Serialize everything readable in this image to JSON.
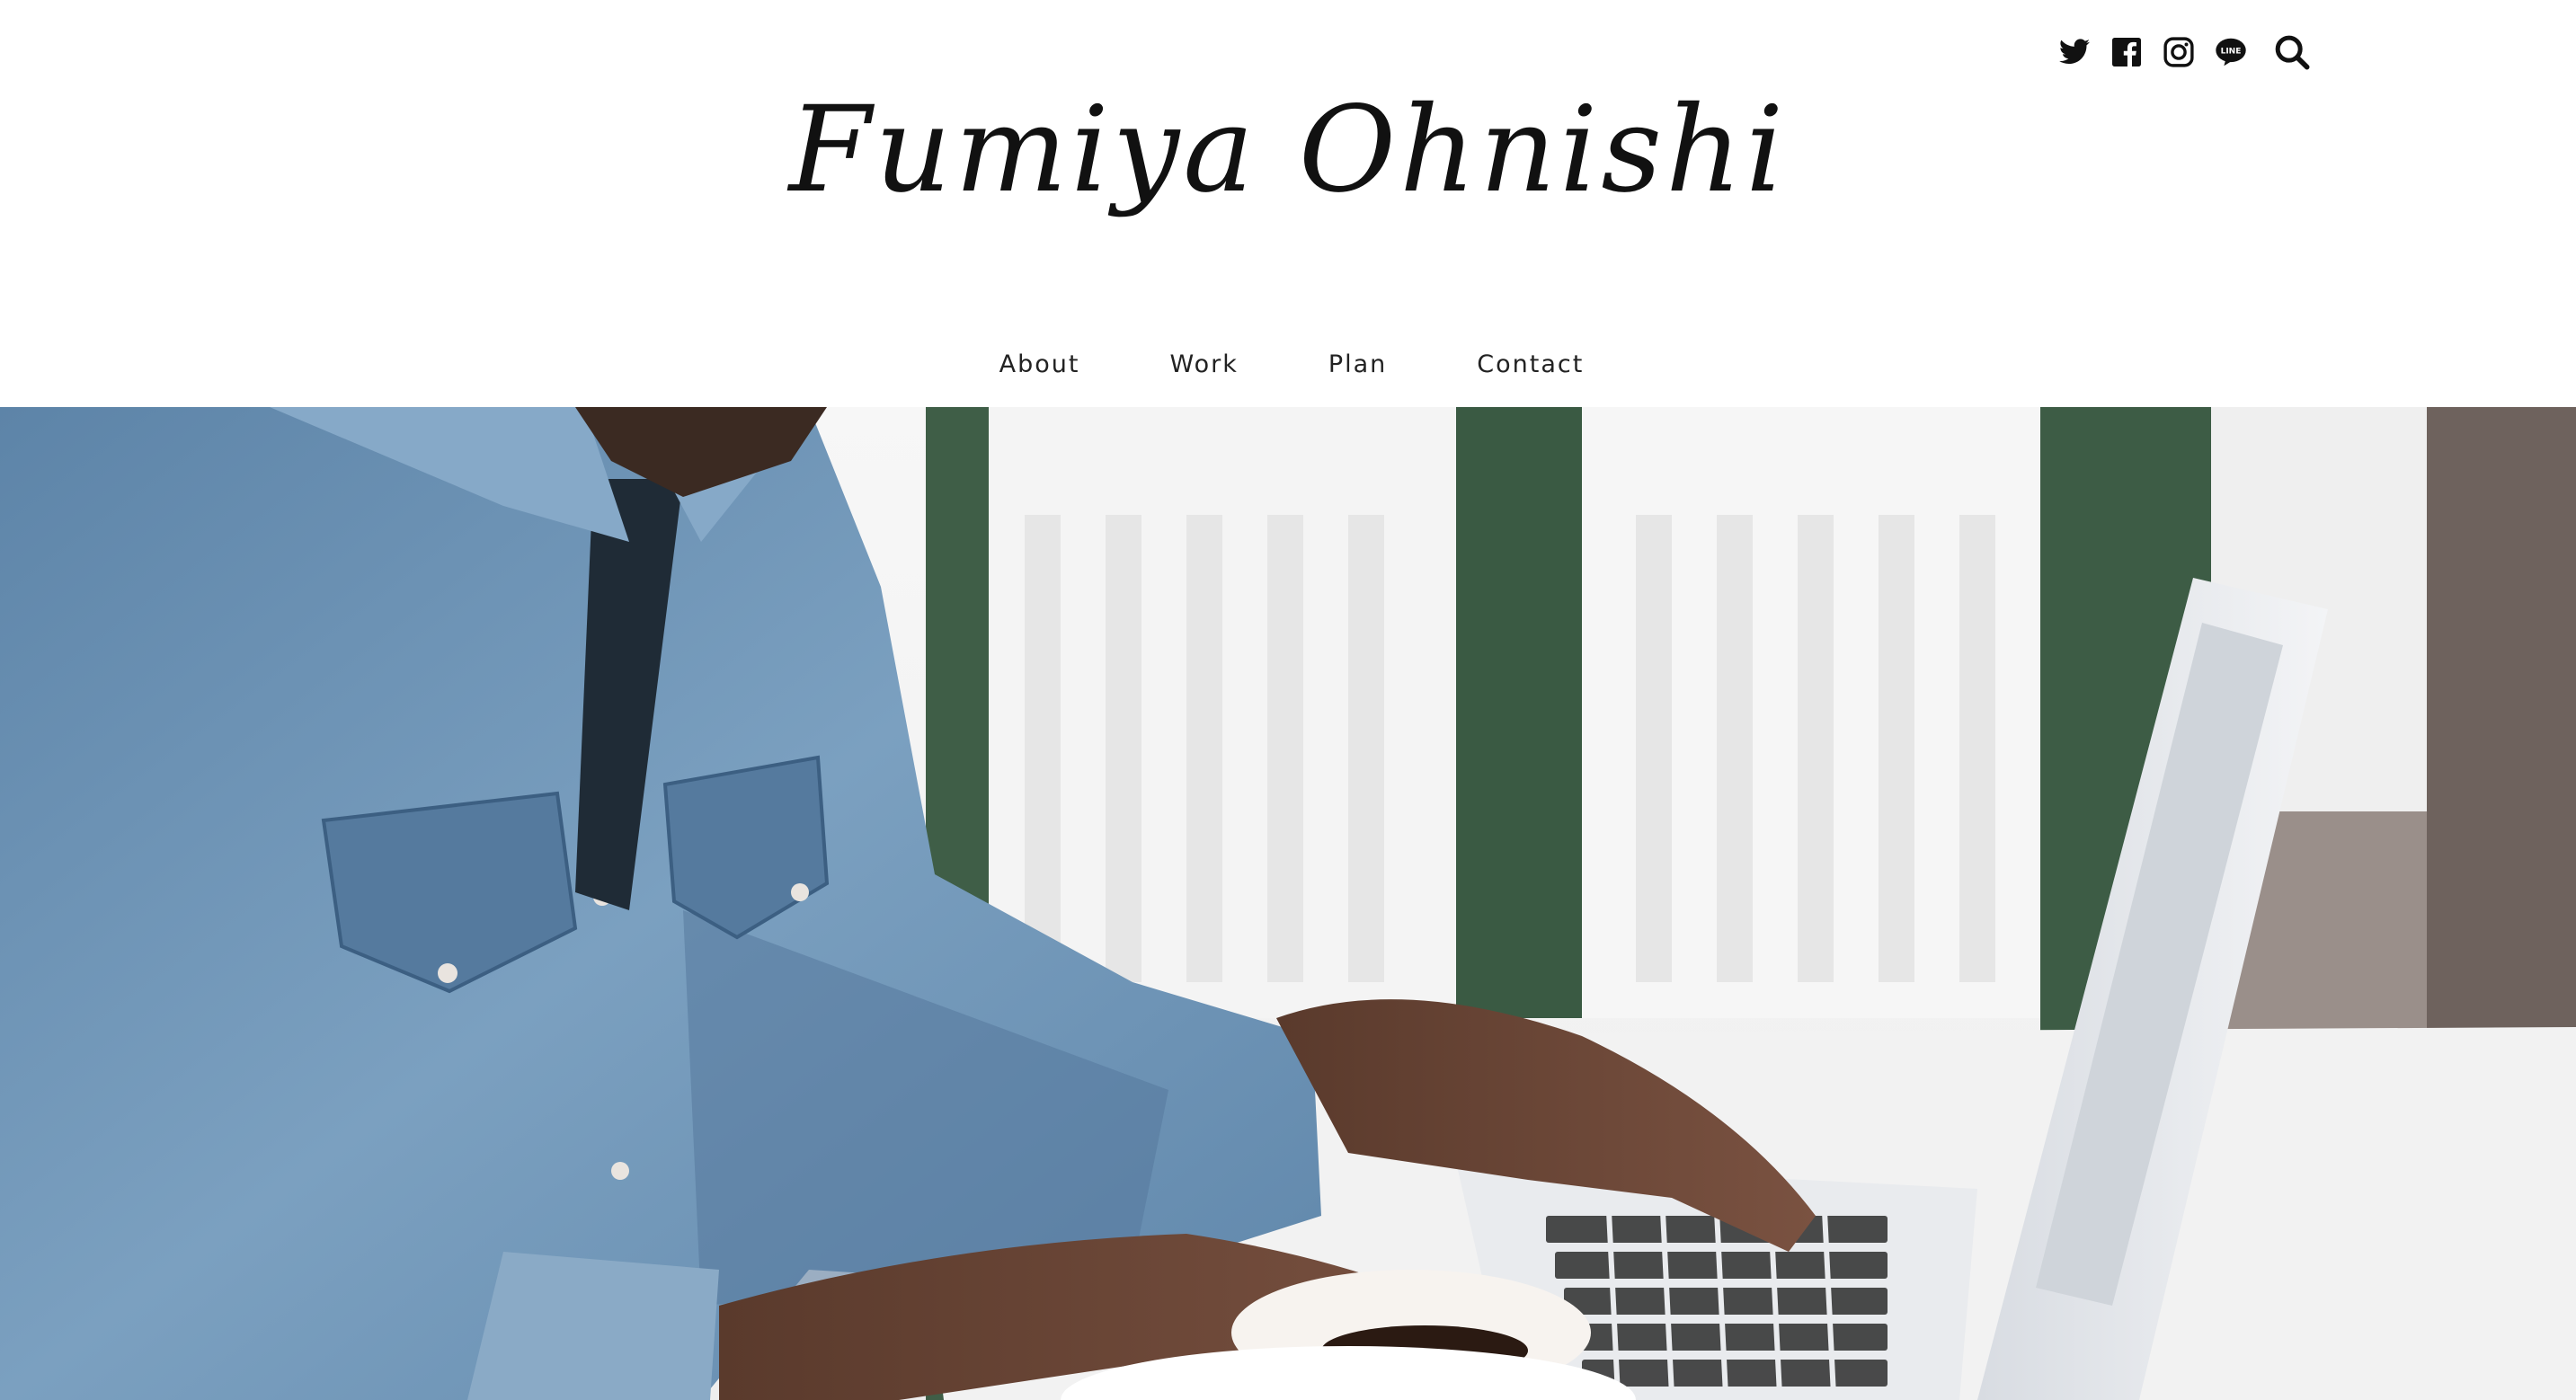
{
  "site": {
    "title": "Fumiya Ohnishi"
  },
  "social": {
    "icons": [
      "twitter-icon",
      "facebook-icon",
      "instagram-icon",
      "line-icon",
      "search-icon"
    ],
    "line_text": "LINE"
  },
  "nav": {
    "items": [
      {
        "label": "About"
      },
      {
        "label": "Work"
      },
      {
        "label": "Plan"
      },
      {
        "label": "Contact"
      }
    ]
  },
  "hero": {
    "alt": "Man in denim shirt typing on a laptop with a cup of coffee"
  },
  "colors": {
    "text": "#111111",
    "background": "#ffffff",
    "denim": "#6f94b6"
  }
}
